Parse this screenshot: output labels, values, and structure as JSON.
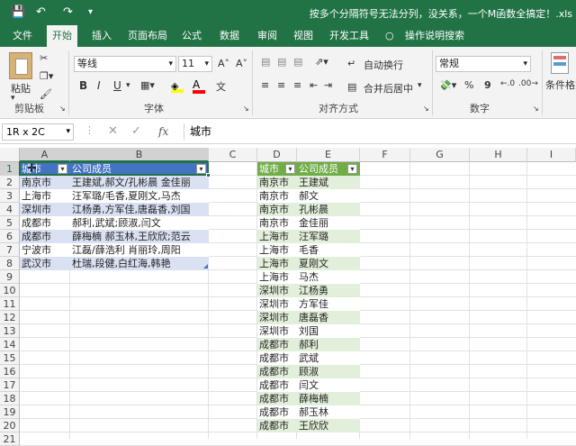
{
  "titlebar": {
    "title": "按多个分隔符号无法分列，没关系，一个M函数全搞定！.xls"
  },
  "tabs": [
    "文件",
    "开始",
    "插入",
    "页面布局",
    "公式",
    "数据",
    "审阅",
    "视图",
    "开发工具",
    "操作说明搜索"
  ],
  "ribbon": {
    "paste": "粘贴",
    "clipboard_label": "剪贴板",
    "font_name": "等线",
    "font_size": "11",
    "bold": "B",
    "italic": "I",
    "underline": "U",
    "grow": "A˄",
    "shrink": "A˅",
    "wen": "文",
    "font_label": "字体",
    "wrap": "自动换行",
    "merge": "合并后居中",
    "align_label": "对齐方式",
    "num_format": "常规",
    "percent": "%",
    "comma": "9",
    "number_label": "数字",
    "cond": "条件格式"
  },
  "formula": {
    "namebox": "1R x 2C",
    "fx": "fx",
    "content": "城市"
  },
  "columns": [
    "A",
    "B",
    "C",
    "D",
    "E",
    "F",
    "G",
    "H",
    "I"
  ],
  "rows": [
    "1",
    "2",
    "3",
    "4",
    "5",
    "6",
    "7",
    "8",
    "9",
    "10",
    "11",
    "12",
    "13",
    "14",
    "15",
    "16",
    "17",
    "18",
    "19",
    "20",
    "21"
  ],
  "table1": {
    "headers": [
      "城市",
      "公司成员"
    ],
    "rows": [
      [
        "南京市",
        "王建斌,郝文/孔彬晨 金佳丽"
      ],
      [
        "上海市",
        "汪军璐/毛香,夏刚文,马杰"
      ],
      [
        "深圳市",
        "江杨勇,方军佳,唐磊香,刘国"
      ],
      [
        "成都市",
        "郝利,武斌;顾淑,闫文"
      ],
      [
        "成都市",
        "薛梅楠 郝玉林,王欣欣;范云"
      ],
      [
        "宁波市",
        "江磊/薛浩利 肖丽玲,周阳"
      ],
      [
        "武汉市",
        "杜瑞,段健,白红海,韩艳"
      ]
    ]
  },
  "table2": {
    "headers": [
      "城市",
      "公司成员"
    ],
    "rows": [
      [
        "南京市",
        "王建斌"
      ],
      [
        "南京市",
        "郝文"
      ],
      [
        "南京市",
        "孔彬晨"
      ],
      [
        "南京市",
        "金佳丽"
      ],
      [
        "上海市",
        "汪军璐"
      ],
      [
        "上海市",
        "毛香"
      ],
      [
        "上海市",
        "夏刚文"
      ],
      [
        "上海市",
        "马杰"
      ],
      [
        "深圳市",
        "江杨勇"
      ],
      [
        "深圳市",
        "方军佳"
      ],
      [
        "深圳市",
        "唐磊香"
      ],
      [
        "深圳市",
        "刘国"
      ],
      [
        "成都市",
        "郝利"
      ],
      [
        "成都市",
        "武斌"
      ],
      [
        "成都市",
        "顾淑"
      ],
      [
        "成都市",
        "闫文"
      ],
      [
        "成都市",
        "薛梅楠"
      ],
      [
        "成都市",
        "郝玉林"
      ],
      [
        "成都市",
        "王欣欣"
      ]
    ]
  }
}
